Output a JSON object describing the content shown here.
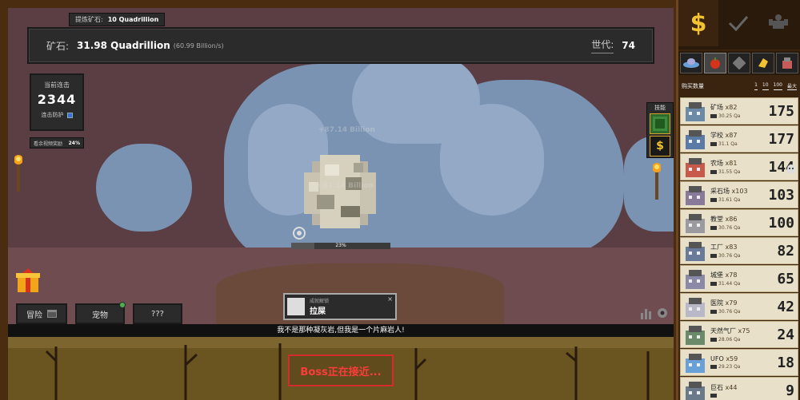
{
  "header": {
    "refine_label": "提炼矿石:",
    "refine_value": "10 Quadrillion",
    "ore_label": "矿石:",
    "ore_value": "31.98 Quadrillion",
    "ore_rate": "(60.99 Billion/s)",
    "generation_label": "世代:",
    "generation_value": "74"
  },
  "combo": {
    "title": "当前连击",
    "count": "2344",
    "protect_label": "连击防护",
    "protect_checked": true
  },
  "video_bonus": {
    "label": "看余视频奖励",
    "value": "24%"
  },
  "rock": {
    "float_text_1": "+87.14 Billion",
    "float_text_2": "+87.14 Billion",
    "progress_label": "23%",
    "progress_fraction": 0.23
  },
  "skills": {
    "title": "技能"
  },
  "bottom_tabs": [
    {
      "label": "冒险"
    },
    {
      "label": "宠物"
    },
    {
      "label": "???"
    }
  ],
  "achievement": {
    "subtitle": "成就解锁",
    "title": "拉屎",
    "close": "×"
  },
  "quote": "我不是那种凝灰岩,但我是一个片麻岩人!",
  "boss": {
    "text": "Boss正在接近..."
  },
  "shop": {
    "buy_label": "购买数量",
    "buy_options": [
      "1",
      "10",
      "100",
      "最大"
    ],
    "items": [
      {
        "name": "矿场",
        "qty": "x82",
        "cost": "30.25 Qa",
        "count": "175"
      },
      {
        "name": "学校",
        "qty": "x87",
        "cost": "31.1 Qa",
        "count": "177"
      },
      {
        "name": "农场",
        "qty": "x81",
        "cost": "31.55 Qa",
        "count": "144"
      },
      {
        "name": "采石场",
        "qty": "x103",
        "cost": "31.61 Qa",
        "count": "103"
      },
      {
        "name": "教堂",
        "qty": "x86",
        "cost": "30.76 Qa",
        "count": "100"
      },
      {
        "name": "工厂",
        "qty": "x83",
        "cost": "30.76 Qa",
        "count": "82"
      },
      {
        "name": "城堡",
        "qty": "x78",
        "cost": "31.44 Qa",
        "count": "65"
      },
      {
        "name": "医院",
        "qty": "x79",
        "cost": "30.76 Qa",
        "count": "42"
      },
      {
        "name": "天然气厂",
        "qty": "x75",
        "cost": "28.06 Qa",
        "count": "24"
      },
      {
        "name": "UFO",
        "qty": "x59",
        "cost": "29.23 Qa",
        "count": "18"
      },
      {
        "name": "巨石",
        "qty": "x44",
        "cost": "",
        "count": "9"
      }
    ]
  },
  "colors": {
    "gold": "#f2c230",
    "boss_red": "#ff3b3b",
    "panel_bg": "#e8e0c8"
  }
}
